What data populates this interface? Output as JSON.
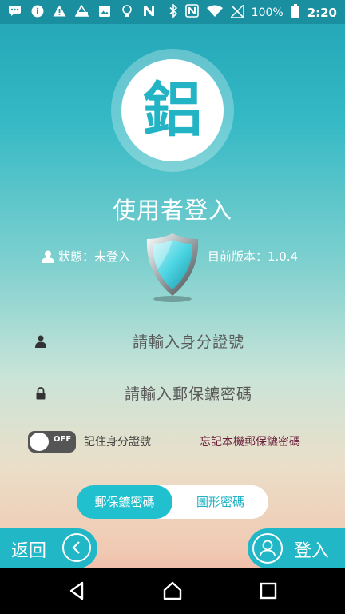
{
  "status_bar": {
    "battery": "100%",
    "time": "2:20",
    "left_icons": [
      "message-icon",
      "info-icon",
      "warning-icon",
      "cards-icon",
      "image-icon",
      "bulb-icon",
      "n-icon"
    ],
    "right_icons": [
      "bluetooth-icon",
      "nfc-icon",
      "wifi-icon",
      "no-signal-icon",
      "battery-icon"
    ]
  },
  "logo": {
    "glyph": "鋁"
  },
  "title": "使用者登入",
  "status": {
    "login_status": "狀態：未登入",
    "version": "目前版本：1.0.4"
  },
  "form": {
    "id_placeholder": "請輸入身分證號",
    "password_placeholder": "請輸入郵保鑣密碼",
    "remember_toggle": "OFF",
    "remember_label": "記住身分證號",
    "forgot_link": "忘記本機郵保鑣密碼"
  },
  "mode_tabs": {
    "active": "郵保鑣密碼",
    "inactive": "圖形密碼"
  },
  "actions": {
    "back": "返回",
    "login": "登入"
  },
  "colors": {
    "accent": "#22b7c6",
    "link": "#6b1f3d"
  }
}
